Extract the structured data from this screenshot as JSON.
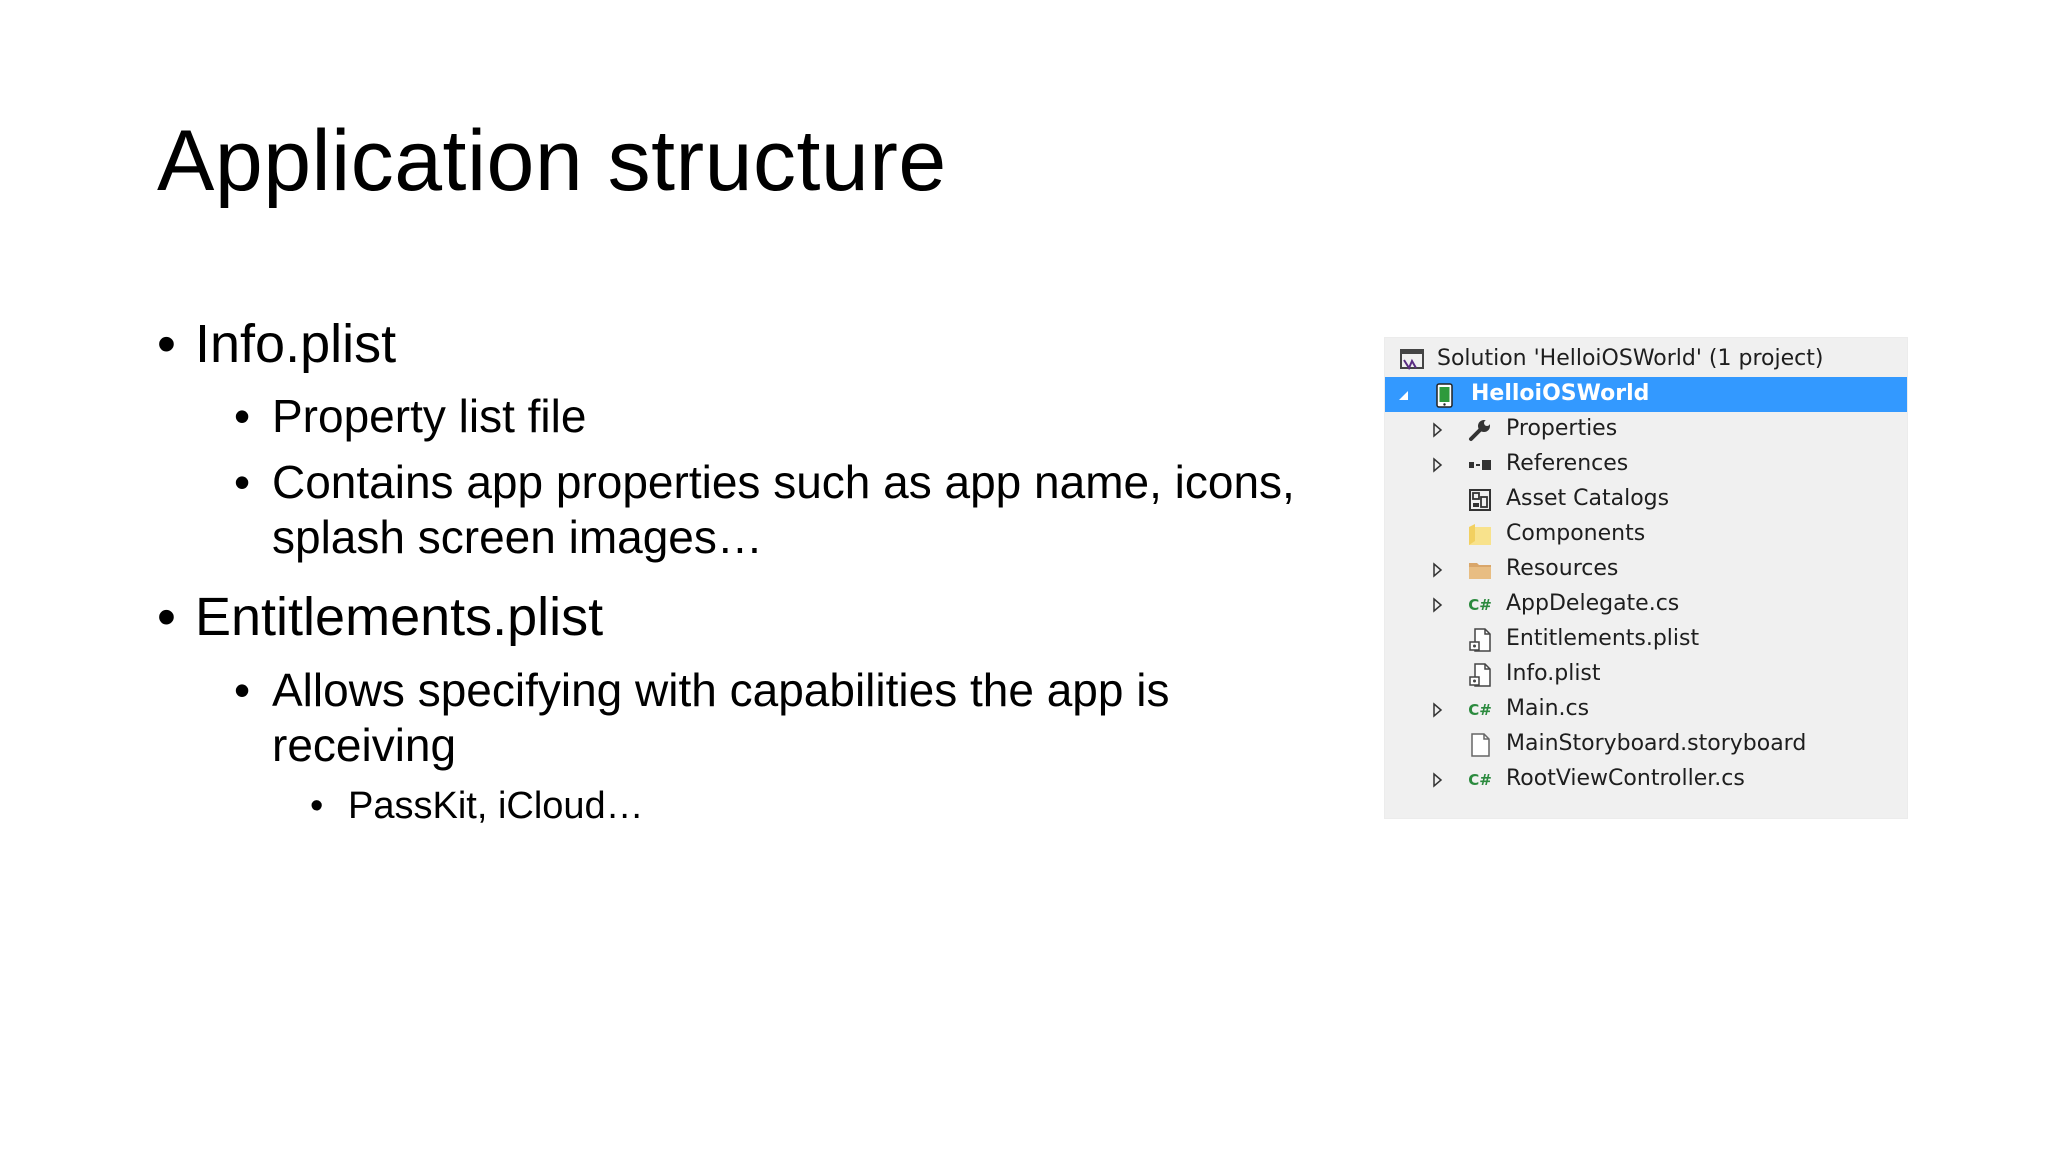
{
  "slide": {
    "title": "Application structure",
    "bullets": [
      {
        "marker": "•",
        "text": "Info.plist"
      },
      {
        "marker": "•",
        "text": "Property list file"
      },
      {
        "marker": "•",
        "text": "Contains app properties such as app name, icons,"
      },
      {
        "marker": "",
        "text": "splash screen images…"
      },
      {
        "marker": "•",
        "text": "Entitlements.plist"
      },
      {
        "marker": "•",
        "text": "Allows specifying with capabilities the app is"
      },
      {
        "marker": "",
        "text": "receiving"
      },
      {
        "marker": "•",
        "text": "PassKit, iCloud…"
      }
    ]
  },
  "solution_explorer": {
    "selection_color": "#3399ff",
    "items": [
      {
        "label": "Solution 'HelloiOSWorld' (1 project)",
        "icon": "solution-icon",
        "expander": "none",
        "selected": false
      },
      {
        "label": "HelloiOSWorld",
        "icon": "ios-project-icon",
        "expander": "expanded",
        "selected": true
      },
      {
        "label": "Properties",
        "icon": "wrench-icon",
        "expander": "collapsed",
        "selected": false
      },
      {
        "label": "References",
        "icon": "references-icon",
        "expander": "collapsed",
        "selected": false
      },
      {
        "label": "Asset Catalogs",
        "icon": "asset-catalog-icon",
        "expander": "none",
        "selected": false
      },
      {
        "label": "Components",
        "icon": "folder-icon",
        "expander": "none",
        "selected": false
      },
      {
        "label": "Resources",
        "icon": "folder-icon",
        "expander": "collapsed",
        "selected": false
      },
      {
        "label": "AppDelegate.cs",
        "icon": "csharp-file-icon",
        "expander": "collapsed",
        "selected": false
      },
      {
        "label": "Entitlements.plist",
        "icon": "plist-file-icon",
        "expander": "none",
        "selected": false
      },
      {
        "label": "Info.plist",
        "icon": "plist-file-icon",
        "expander": "none",
        "selected": false
      },
      {
        "label": "Main.cs",
        "icon": "csharp-file-icon",
        "expander": "collapsed",
        "selected": false
      },
      {
        "label": "MainStoryboard.storyboard",
        "icon": "file-icon",
        "expander": "none",
        "selected": false
      },
      {
        "label": "RootViewController.cs",
        "icon": "csharp-file-icon",
        "expander": "collapsed",
        "selected": false
      }
    ]
  }
}
